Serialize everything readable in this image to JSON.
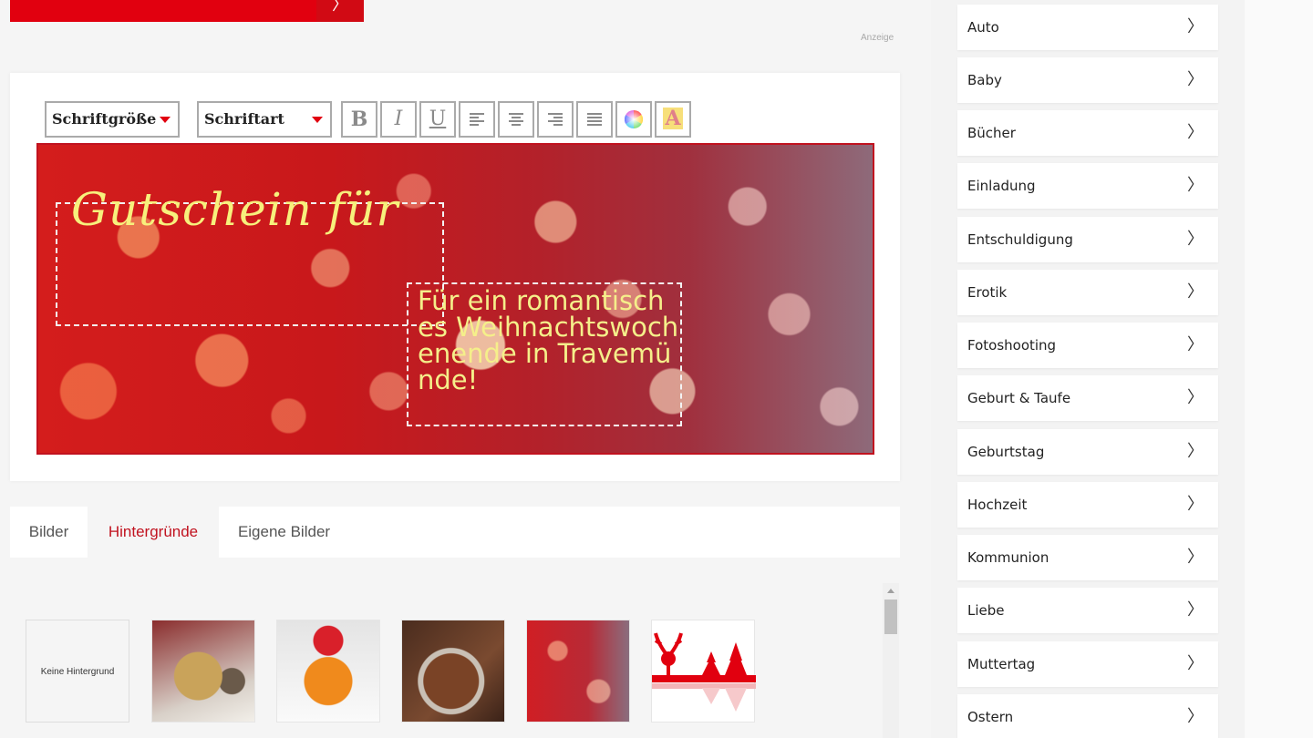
{
  "banner": {
    "arrow": "〉"
  },
  "ad_label": "Anzeige",
  "toolbar": {
    "font_size_label": "Schriftgröße",
    "font_family_label": "Schriftart",
    "bold": "B",
    "italic": "I",
    "underline": "U",
    "highlight": "A"
  },
  "canvas": {
    "title": "Gutschein für",
    "body": "Für ein romantisches Weihnachtswochenende in Travemünde!"
  },
  "tabs": [
    {
      "label": "Bilder"
    },
    {
      "label": "Hintergründe"
    },
    {
      "label": "Eigene Bilder"
    }
  ],
  "thumbnails": {
    "none_label": "Keine Hintergrund"
  },
  "categories": [
    {
      "label": "Auto"
    },
    {
      "label": "Baby"
    },
    {
      "label": "Bücher"
    },
    {
      "label": "Einladung"
    },
    {
      "label": "Entschuldigung"
    },
    {
      "label": "Erotik"
    },
    {
      "label": "Fotoshooting"
    },
    {
      "label": "Geburt & Taufe"
    },
    {
      "label": "Geburtstag"
    },
    {
      "label": "Hochzeit"
    },
    {
      "label": "Kommunion"
    },
    {
      "label": "Liebe"
    },
    {
      "label": "Muttertag"
    },
    {
      "label": "Ostern"
    }
  ],
  "chevron": "〉",
  "colors": {
    "accent": "#e1000f",
    "canvas_text": "#f7f07c"
  }
}
